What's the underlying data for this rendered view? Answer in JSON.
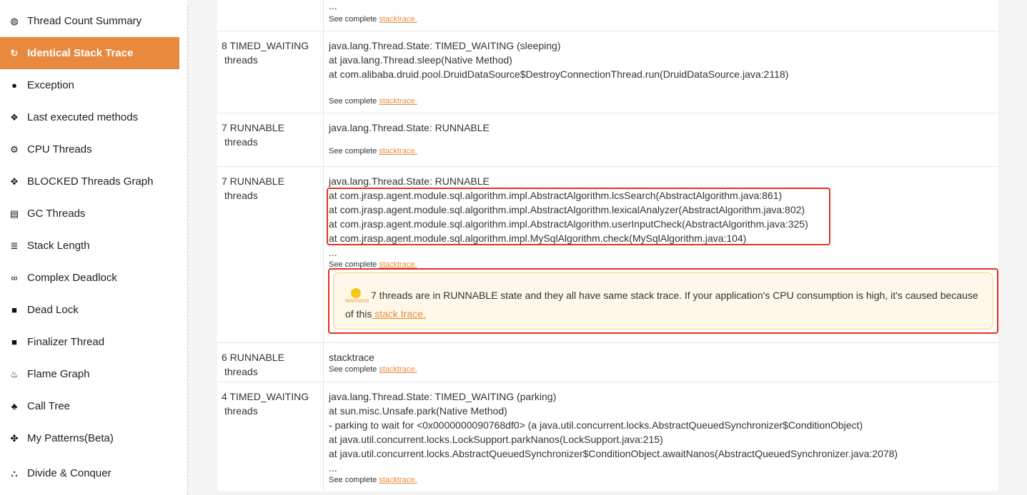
{
  "sidebar": {
    "items": [
      {
        "label": "Thread Count Summary",
        "icon": "dashboard-icon",
        "glyph": "◍",
        "active": false
      },
      {
        "label": "Identical Stack Trace",
        "icon": "refresh-icon",
        "glyph": "↻",
        "active": true
      },
      {
        "label": "Exception",
        "icon": "exclamation-circle-icon",
        "glyph": "●",
        "active": false
      },
      {
        "label": "Last executed methods",
        "icon": "cubes-icon",
        "glyph": "❖",
        "active": false
      },
      {
        "label": "CPU Threads",
        "icon": "cogs-icon",
        "glyph": "⚙",
        "active": false
      },
      {
        "label": "BLOCKED Threads Graph",
        "icon": "crosshair-icon",
        "glyph": "✥",
        "active": false
      },
      {
        "label": "GC Threads",
        "icon": "trash-icon",
        "glyph": "▤",
        "active": false
      },
      {
        "label": "Stack Length",
        "icon": "stack-icon",
        "glyph": "≣",
        "active": false
      },
      {
        "label": "Complex Deadlock",
        "icon": "link-icon",
        "glyph": "∞",
        "active": false
      },
      {
        "label": "Dead Lock",
        "icon": "lock-icon",
        "glyph": "■",
        "active": false
      },
      {
        "label": "Finalizer Thread",
        "icon": "square-icon",
        "glyph": "■",
        "active": false
      },
      {
        "label": "Flame Graph",
        "icon": "fire-icon",
        "glyph": "♨",
        "active": false
      },
      {
        "label": "Call Tree",
        "icon": "tree-icon",
        "glyph": "♣",
        "active": false
      },
      {
        "label": "My Patterns(Beta)",
        "icon": "puzzle-icon",
        "glyph": "✤",
        "active": false
      },
      {
        "label": "Divide & Conquer",
        "icon": "sitemap-icon",
        "glyph": "⛬",
        "active": false
      }
    ]
  },
  "table": {
    "see_complete_prefix": "See complete",
    "stacktrace_link": "stacktrace.",
    "top_partial": {
      "ellipsis": "..."
    },
    "rows": [
      {
        "count": "8 TIMED_WAITING",
        "unit": "threads",
        "lines": [
          "java.lang.Thread.State: TIMED_WAITING (sleeping)",
          "at java.lang.Thread.sleep(Native Method)",
          "at com.alibaba.druid.pool.DruidDataSource$DestroyConnectionThread.run(DruidDataSource.java:2118)"
        ]
      },
      {
        "count": "7 RUNNABLE",
        "unit": "threads",
        "lines": [
          "java.lang.Thread.State: RUNNABLE"
        ]
      },
      {
        "count": "7 RUNNABLE",
        "unit": "threads",
        "lines": [
          "java.lang.Thread.State: RUNNABLE",
          "at com.jrasp.agent.module.sql.algorithm.impl.AbstractAlgorithm.lcsSearch(AbstractAlgorithm.java:861)",
          "at com.jrasp.agent.module.sql.algorithm.impl.AbstractAlgorithm.lexicalAnalyzer(AbstractAlgorithm.java:802)",
          "at com.jrasp.agent.module.sql.algorithm.impl.AbstractAlgorithm.userInputCheck(AbstractAlgorithm.java:325)",
          "at com.jrasp.agent.module.sql.algorithm.impl.MySqlAlgorithm.check(MySqlAlgorithm.java:104)",
          "..."
        ],
        "warning": {
          "icon_label": "WARNING",
          "text": "7 threads are in RUNNABLE state and they all have same stack trace. If your application's CPU consumption is high, it's caused because of this",
          "link": " stack trace."
        }
      },
      {
        "count": "6 RUNNABLE",
        "unit": "threads",
        "lines": [
          "stacktrace"
        ]
      },
      {
        "count": "4 TIMED_WAITING",
        "unit": "threads",
        "lines": [
          "java.lang.Thread.State: TIMED_WAITING (parking)",
          "at sun.misc.Unsafe.park(Native Method)",
          "- parking to wait for  <0x0000000090768df0> (a java.util.concurrent.locks.AbstractQueuedSynchronizer$ConditionObject)",
          "at java.util.concurrent.locks.LockSupport.parkNanos(LockSupport.java:215)",
          "at java.util.concurrent.locks.AbstractQueuedSynchronizer$ConditionObject.awaitNanos(AbstractQueuedSynchronizer.java:2078)",
          "..."
        ]
      }
    ]
  },
  "colors": {
    "accent": "#e8893d",
    "highlight_border": "#e0321e",
    "warning_bg": "#fff8e8"
  }
}
